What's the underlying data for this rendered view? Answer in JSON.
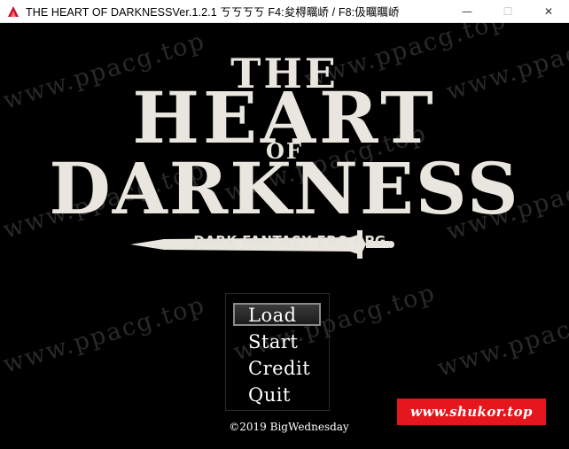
{
  "window": {
    "title": "THE HEART OF DARKNESSVer.1.2.1 ㄎㄎㄎㄎ F4:夋棏曞峤 / F8:伋曞曞峤",
    "minimize_glyph": "—",
    "maximize_glyph": "☐",
    "close_glyph": "✕"
  },
  "logo": {
    "line1": "THE",
    "line2": "HEART",
    "line3": "OF",
    "line4": "DARKNESS",
    "subtitle": "DARK FANTASY ERO RPG"
  },
  "menu": {
    "items": [
      "Load",
      "Start",
      "Credit",
      "Quit"
    ],
    "selected": "Load"
  },
  "copyright": "©2019 BigWednesday",
  "badge": {
    "text": "www.shukor.top",
    "color": "#e5161c"
  },
  "watermark": {
    "text": "www.ppacg.top"
  },
  "icons": {
    "app": "rpg-maker-app-icon",
    "minimize": "minimize-icon",
    "maximize": "maximize-icon",
    "close": "close-icon"
  }
}
